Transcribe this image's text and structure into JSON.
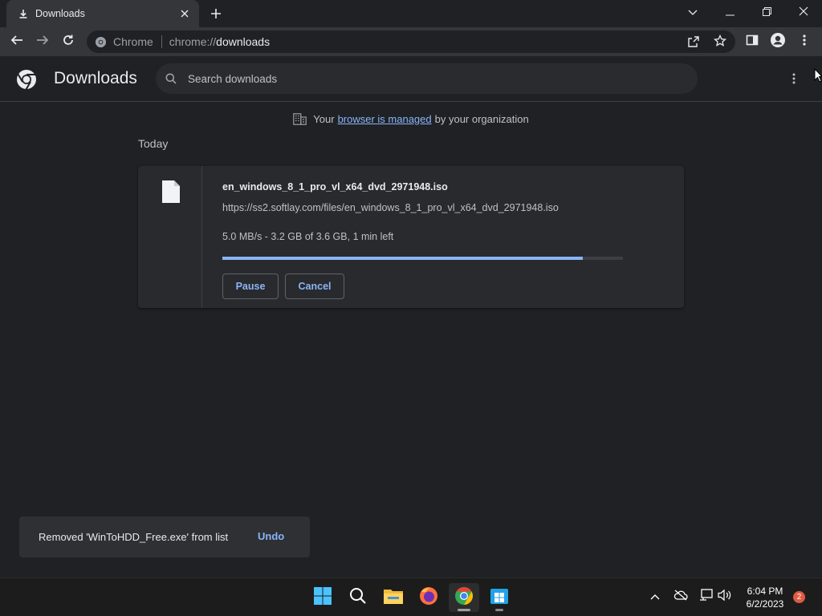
{
  "colors": {
    "accent": "#8ab4f8",
    "background": "#202124",
    "toolbar": "#35363a",
    "card": "#292a2d",
    "notification_badge": "#e05a43"
  },
  "tab": {
    "title": "Downloads",
    "icon": "download-icon"
  },
  "window_controls": [
    "chevron-down-icon",
    "minimize-icon",
    "restore-icon",
    "close-icon"
  ],
  "toolbar": {
    "back_icon": "back-arrow-icon",
    "forward_icon": "forward-arrow-icon",
    "reload_icon": "reload-icon",
    "site_chip_label": "Chrome",
    "url_scheme": "chrome://",
    "url_host": "downloads",
    "right_icons": [
      "share-icon",
      "star-icon",
      "side-panel-icon",
      "profile-icon",
      "kebab-menu-icon"
    ]
  },
  "downloads_page": {
    "title": "Downloads",
    "search_placeholder": "Search downloads",
    "managed_prefix": "Your",
    "managed_link": "browser is managed",
    "managed_suffix": "by your organization",
    "section_label": "Today",
    "items": [
      {
        "file_name": "en_windows_8_1_pro_vl_x64_dvd_2971948.iso",
        "url": "https://ss2.softlay.com/files/en_windows_8_1_pro_vl_x64_dvd_2971948.iso",
        "status": "5.0 MB/s - 3.2 GB of 3.6 GB, 1 min left",
        "progress": 0.9,
        "pause_label": "Pause",
        "cancel_label": "Cancel"
      }
    ]
  },
  "toast": {
    "message": "Removed 'WinToHDD_Free.exe' from list",
    "undo_label": "Undo"
  },
  "taskbar": {
    "apps": [
      "windows-start-icon",
      "search-icon",
      "file-explorer-icon",
      "firefox-icon",
      "chrome-icon",
      "windows-store-icon"
    ],
    "tray_icons": [
      "chevron-up-icon",
      "cloud-offline-icon",
      "network-icon",
      "volume-icon"
    ],
    "time": "6:04 PM",
    "date": "6/2/2023",
    "notification_count": "2"
  }
}
